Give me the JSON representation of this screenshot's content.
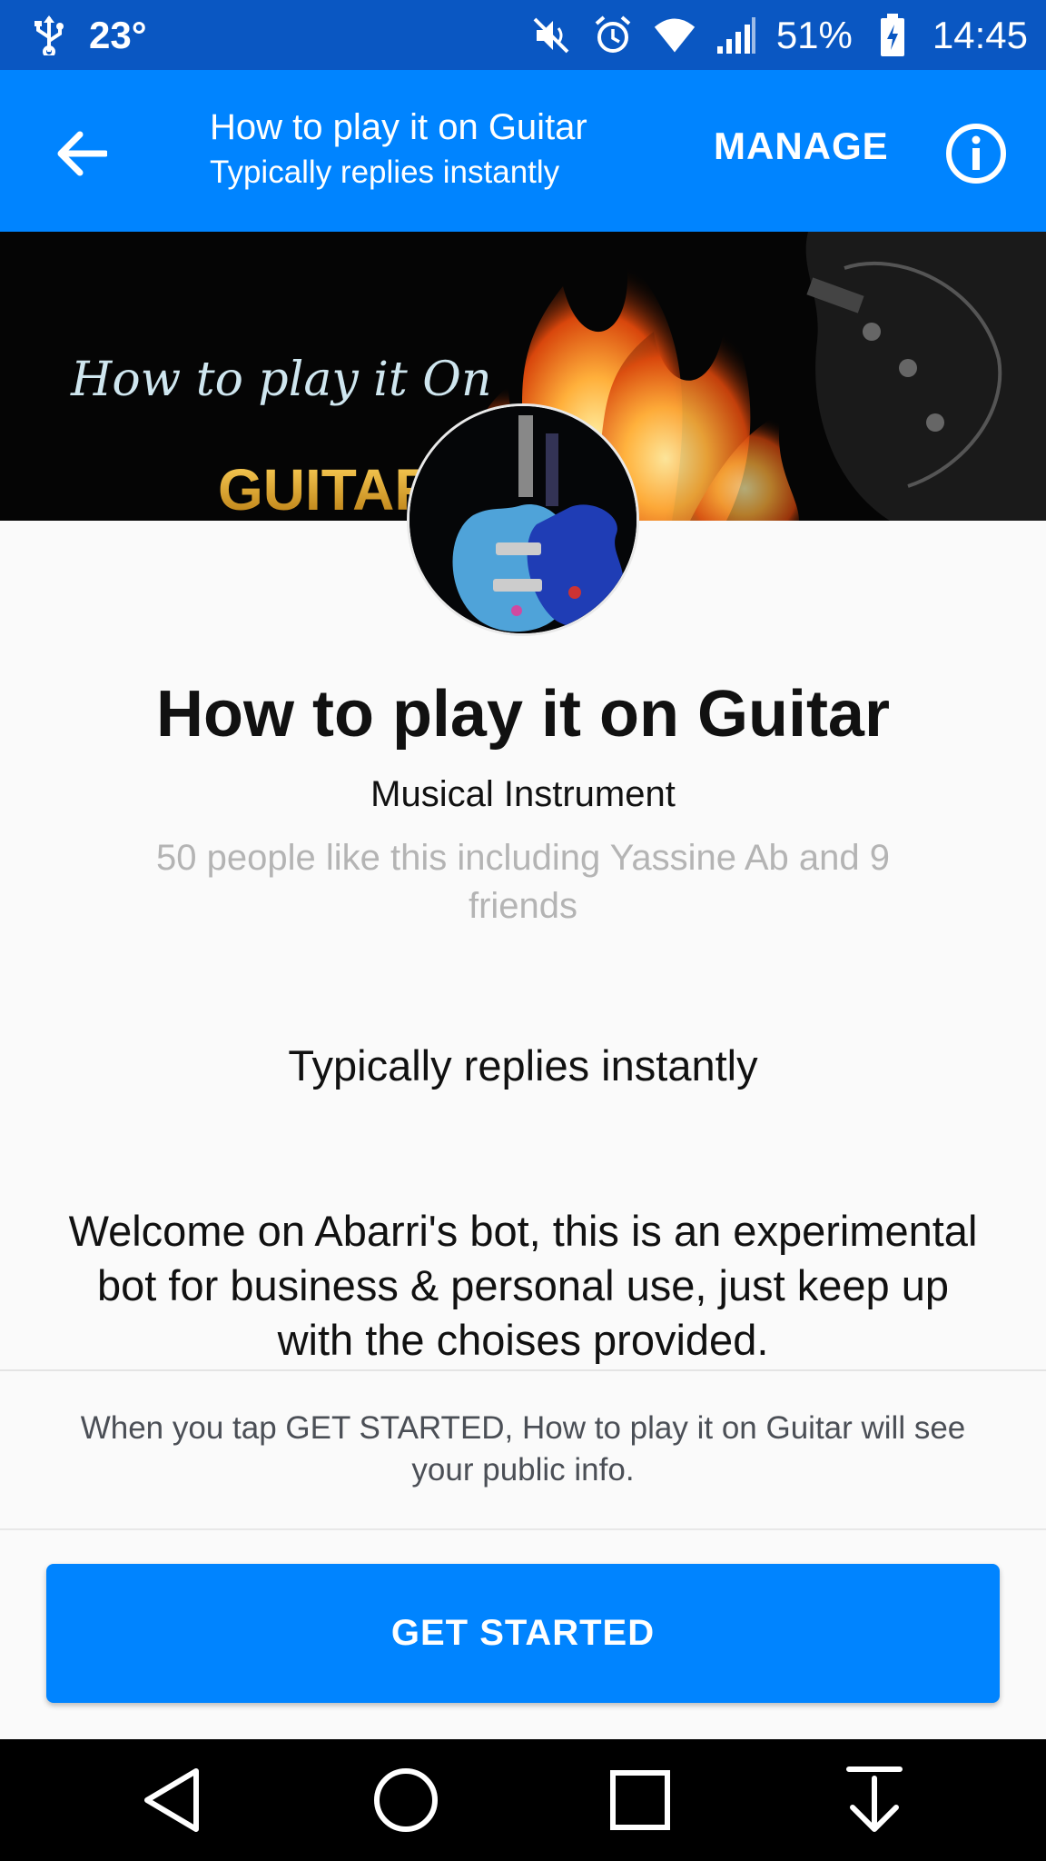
{
  "status_bar": {
    "temperature": "23°",
    "battery": "51%",
    "time": "14:45",
    "icons": [
      "usb-icon",
      "mute-icon",
      "alarm-icon",
      "wifi-icon",
      "signal-icon",
      "battery-charging-icon"
    ]
  },
  "header": {
    "title": "How to play it on Guitar",
    "subtitle": "Typically replies instantly",
    "manage_label": "MANAGE",
    "back_icon": "arrow-left-icon",
    "info_icon": "info-icon"
  },
  "cover": {
    "logo_line1": "How to play it On",
    "logo_line2": "GUITAR"
  },
  "profile": {
    "name": "How to play it on Guitar",
    "category": "Musical Instrument",
    "likes": "50 people like this including Yassine Ab and 9 friends",
    "response": "Typically replies instantly",
    "welcome": "Welcome on Abarri's bot, this is an experimental bot for business & personal use, just keep up with the choises provided."
  },
  "consent": {
    "text": "When you tap GET STARTED, How to play it on Guitar will see your public info."
  },
  "cta": {
    "label": "GET STARTED"
  },
  "colors": {
    "status_bar": "#0a57c2",
    "header": "#0084ff",
    "button": "#0084ff"
  }
}
